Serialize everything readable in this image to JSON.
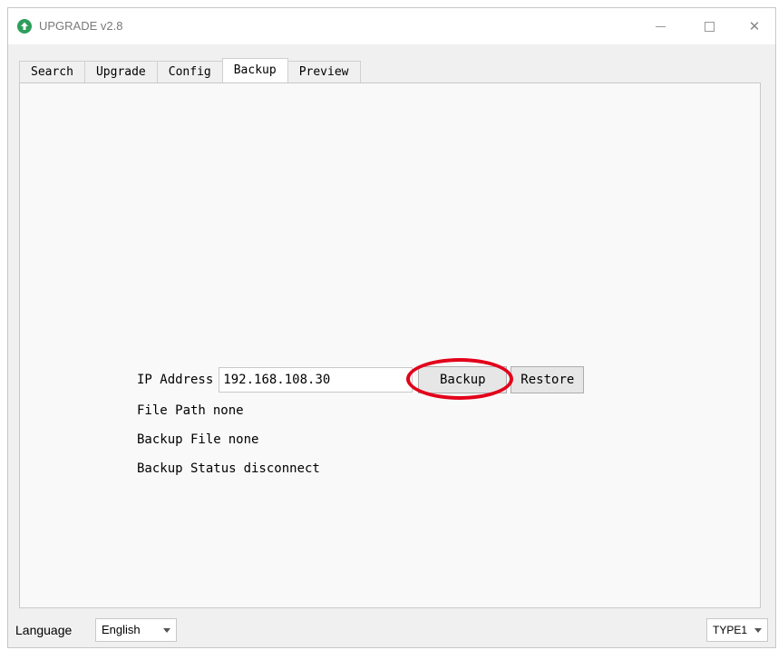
{
  "window": {
    "title": "UPGRADE v2.8",
    "controls": {
      "minimize_icon": "minimize-icon",
      "maximize_icon": "maximize-icon",
      "close_icon": "close-icon",
      "close_glyph": "✕"
    }
  },
  "tabs": [
    {
      "label": "Search",
      "active": false
    },
    {
      "label": "Upgrade",
      "active": false
    },
    {
      "label": "Config",
      "active": false
    },
    {
      "label": "Backup",
      "active": true
    },
    {
      "label": "Preview",
      "active": false
    }
  ],
  "backup": {
    "ip_label": "IP Address",
    "ip_value": "192.168.108.30",
    "backup_button": "Backup",
    "restore_button": "Restore",
    "file_path_label": "File Path",
    "file_path_value": "none",
    "backup_file_label": "Backup File",
    "backup_file_value": "none",
    "backup_status_label": "Backup Status",
    "backup_status_value": "disconnect"
  },
  "annotation": {
    "highlight_color": "#e2001a"
  },
  "footer": {
    "language_label": "Language",
    "language_selected": "English",
    "type_selected": "TYPE1"
  },
  "colors": {
    "app_icon": "#2e9e5b"
  }
}
